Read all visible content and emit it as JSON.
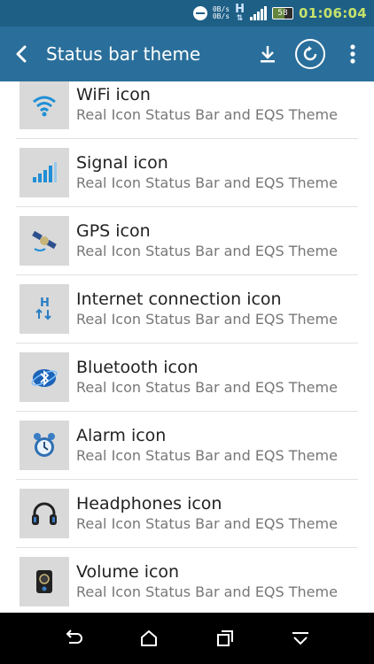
{
  "status_bar": {
    "net_up": "0B/s",
    "net_down": "0B/s",
    "network_type": "H",
    "battery": "58",
    "time": "01:06:04",
    "icons": [
      "do-not-disturb-icon",
      "net-speed-icon",
      "h-network-icon",
      "signal-icon",
      "battery-icon"
    ]
  },
  "app_bar": {
    "title": "Status bar theme",
    "icons": [
      "back-arrow-icon",
      "download-icon",
      "refresh-icon",
      "more-vert-icon"
    ]
  },
  "items": [
    {
      "title": "WiFi icon",
      "subtitle": "Real Icon Status Bar and EQS Theme",
      "icon": "wifi-icon"
    },
    {
      "title": "Signal icon",
      "subtitle": "Real Icon Status Bar and EQS Theme",
      "icon": "signal-bars-icon"
    },
    {
      "title": "GPS icon",
      "subtitle": "Real Icon Status Bar and EQS Theme",
      "icon": "gps-satellite-icon"
    },
    {
      "title": "Internet connection icon",
      "subtitle": "Real Icon Status Bar and EQS Theme",
      "icon": "internet-h-icon"
    },
    {
      "title": "Bluetooth icon",
      "subtitle": "Real Icon Status Bar and EQS Theme",
      "icon": "bluetooth-icon"
    },
    {
      "title": "Alarm icon",
      "subtitle": "Real Icon Status Bar and EQS Theme",
      "icon": "alarm-clock-icon"
    },
    {
      "title": "Headphones icon",
      "subtitle": "Real Icon Status Bar and EQS Theme",
      "icon": "headphones-icon"
    },
    {
      "title": "Volume icon",
      "subtitle": "Real Icon Status Bar and EQS Theme",
      "icon": "volume-icon"
    }
  ],
  "nav_bar": {
    "icons": [
      "back-nav-icon",
      "home-nav-icon",
      "recents-nav-icon",
      "hide-nav-icon"
    ]
  },
  "colors": {
    "status_bar": "#1e5f86",
    "app_bar": "#2a6f9b",
    "clock": "#c6e26a",
    "thumb_bg": "#d9d9d9",
    "divider": "#e2e2e2"
  }
}
